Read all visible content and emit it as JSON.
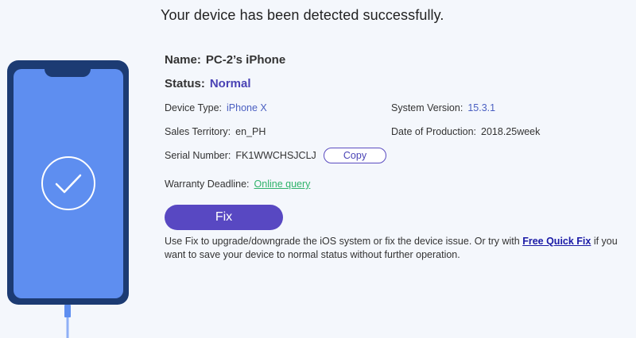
{
  "headline": "Your device has been detected successfully.",
  "device": {
    "name_label": "Name:",
    "name_value": "PC-2’s iPhone",
    "status_label": "Status:",
    "status_value": "Normal",
    "device_type_label": "Device Type:",
    "device_type_value": "iPhone X",
    "system_version_label": "System Version:",
    "system_version_value": "15.3.1",
    "sales_territory_label": "Sales Territory:",
    "sales_territory_value": "en_PH",
    "production_label": "Date of Production:",
    "production_value": "2018.25week",
    "serial_label": "Serial Number:",
    "serial_value": "FK1WWCHSJCLJ",
    "copy_label": "Copy",
    "warranty_label": "Warranty Deadline:",
    "warranty_link": "Online query"
  },
  "actions": {
    "fix_label": "Fix",
    "description_before": "Use Fix to upgrade/downgrade the iOS system or fix the device issue. Or try with ",
    "quick_fix_link": "Free Quick Fix",
    "description_after": " if you want to save your device to normal status without further operation."
  },
  "icons": {
    "phone": "phone-icon",
    "check": "check-circle-icon",
    "cable": "usb-cable-icon"
  },
  "colors": {
    "accent": "#5848c2",
    "status": "#4a43b5",
    "link_green": "#2fb36a",
    "phone_frame": "#1c3b73",
    "phone_screen": "#5e8ef0"
  }
}
